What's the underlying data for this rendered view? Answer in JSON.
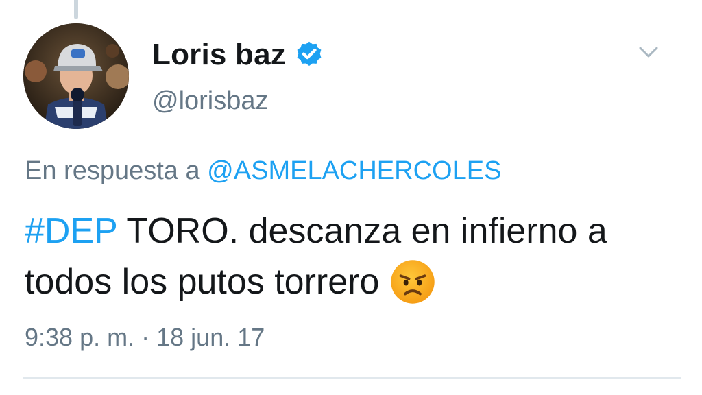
{
  "thread": {
    "connector": "thread-line"
  },
  "author": {
    "name": "Loris baz",
    "handle": "@lorisbaz",
    "verified_icon": "verified-badge-icon",
    "avatar_icon": "profile-photo"
  },
  "menu": {
    "icon": "chevron-down-icon"
  },
  "reply": {
    "prefix": "En respuesta a",
    "mention": "@ASMELACHERCOLES"
  },
  "tweet": {
    "hashtag": "#DEP",
    "text_after_hashtag": " TORO. descanza en infierno a todos los putos torrero",
    "emoji_icon": "angry-face-emoji"
  },
  "meta": {
    "time": "9:38 p. m.",
    "separator": "·",
    "date": "18 jun. 17"
  },
  "colors": {
    "link_blue": "#1da1f2",
    "text_primary": "#14171a",
    "text_secondary": "#657786",
    "divider": "#e1e8ed"
  }
}
